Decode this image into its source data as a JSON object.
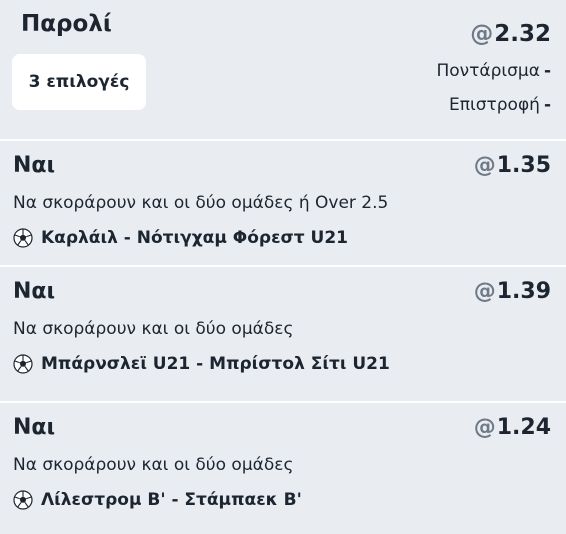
{
  "header": {
    "bet_type": "Παρολί",
    "selections_chip": "3 επιλογές",
    "at": "@",
    "total_odds": "2.32",
    "stake_label": "Ποντάρισμα",
    "stake_value": "-",
    "return_label": "Επιστροφή",
    "return_value": "-"
  },
  "selections": [
    {
      "pick": "Ναι",
      "at": "@",
      "odds": "1.35",
      "market": "Να σκοράρουν και οι δύο ομάδες ή Over 2.5",
      "icon": "soccer-ball-icon",
      "event": "Καρλάιλ - Νότιγχαμ Φόρεστ U21"
    },
    {
      "pick": "Ναι",
      "at": "@",
      "odds": "1.39",
      "market": "Να σκοράρουν και οι δύο ομάδες",
      "icon": "soccer-ball-icon",
      "event": "Μπάρνσλεϊ U21 - Μπρίστολ Σίτι U21"
    },
    {
      "pick": "Ναι",
      "at": "@",
      "odds": "1.24",
      "market": "Να σκοράρουν και οι δύο ομάδες",
      "icon": "soccer-ball-icon",
      "event": "Λίλεστρομ Β' - Στάμπαεκ Β'"
    }
  ],
  "colors": {
    "background": "#e9edf2",
    "text": "#1c2530",
    "at_sign": "#6f7a86",
    "chip": "#ffffff",
    "divider": "#ffffff"
  }
}
